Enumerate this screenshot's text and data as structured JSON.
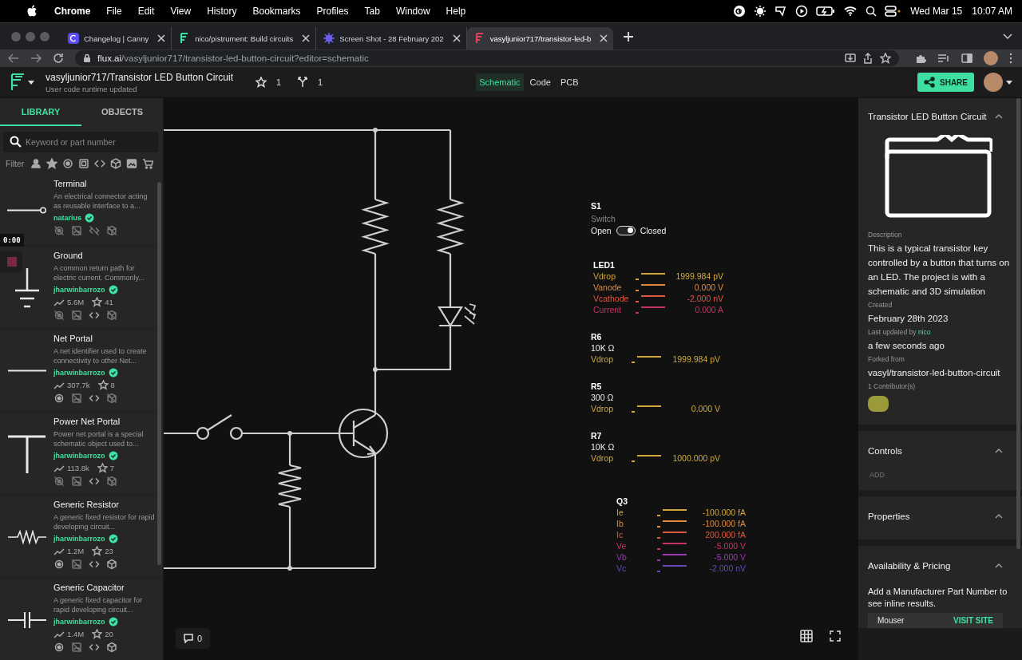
{
  "menu_bar": {
    "app": "Chrome",
    "menus": [
      "File",
      "Edit",
      "View",
      "History",
      "Bookmarks",
      "Profiles",
      "Tab",
      "Window",
      "Help"
    ],
    "date": "Wed Mar 15",
    "time": "10:07 AM"
  },
  "browser": {
    "tabs": [
      {
        "title": "Changelog | Canny",
        "selected": false
      },
      {
        "title": "nico/pistrument: Build circuits",
        "selected": false
      },
      {
        "title": "Screen Shot - 28 February 202",
        "selected": false
      },
      {
        "title": "vasyljunior717/transistor-led-b",
        "selected": true
      }
    ],
    "url_host": "flux.ai",
    "url_path": "/vasyljunior717/transistor-led-button-circuit?editor=schematic"
  },
  "header": {
    "title": "vasyljunior717/Transistor LED Button Circuit",
    "subtitle": "User code runtime updated",
    "stars": "1",
    "forks": "1",
    "editors": [
      {
        "label": "Schematic",
        "selected": true
      },
      {
        "label": "Code",
        "selected": false
      },
      {
        "label": "PCB",
        "selected": false
      }
    ],
    "share": "SHARE"
  },
  "library": {
    "tabs": [
      {
        "label": "LIBRARY",
        "selected": true
      },
      {
        "label": "OBJECTS",
        "selected": false
      }
    ],
    "search": {
      "placeholder": "Keyword or part number"
    },
    "filter_label": "Filter",
    "parts": [
      {
        "kind": "terminal",
        "name": "Terminal",
        "description": "An electrical connector acting as reusable interface to a...",
        "author": "natarius",
        "badges": [
          {
            "kind": "globe",
            "disabled": true
          },
          {
            "kind": "image",
            "disabled": true
          },
          {
            "kind": "code",
            "disabled": true
          },
          {
            "kind": "cube",
            "disabled": true
          }
        ]
      },
      {
        "kind": "ground",
        "name": "Ground",
        "description": "A common return path for electric current. Commonly...",
        "author": "jharwinbarrozo",
        "uses": "5.6M",
        "stars_count": "41",
        "badges": [
          {
            "kind": "globe",
            "disabled": true
          },
          {
            "kind": "image",
            "disabled": true
          },
          {
            "kind": "code",
            "disabled": false
          },
          {
            "kind": "cube",
            "disabled": true
          }
        ]
      },
      {
        "kind": "net",
        "name": "Net Portal",
        "description": "A net identifier used to create connectivity to other Net...",
        "author": "jharwinbarrozo",
        "uses": "307.7k",
        "stars_count": "8",
        "badges": [
          {
            "kind": "globe",
            "disabled": false
          },
          {
            "kind": "image",
            "disabled": true
          },
          {
            "kind": "code",
            "disabled": false
          },
          {
            "kind": "cube",
            "disabled": true
          }
        ]
      },
      {
        "kind": "power",
        "name": "Power Net Portal",
        "description": "Power net portal is a special schematic object used to...",
        "author": "jharwinbarrozo",
        "uses": "113.8k",
        "stars_count": "7",
        "badges": [
          {
            "kind": "globe",
            "disabled": true
          },
          {
            "kind": "image",
            "disabled": true
          },
          {
            "kind": "code",
            "disabled": false
          },
          {
            "kind": "cube",
            "disabled": true
          }
        ]
      },
      {
        "kind": "resistor",
        "name": "Generic Resistor",
        "description": "A generic fixed resistor for rapid developing circuit...",
        "author": "jharwinbarrozo",
        "uses": "1.2M",
        "stars_count": "23",
        "badges": [
          {
            "kind": "globe",
            "disabled": false
          },
          {
            "kind": "image",
            "disabled": true
          },
          {
            "kind": "code",
            "disabled": false
          },
          {
            "kind": "cube",
            "disabled": false
          }
        ]
      },
      {
        "kind": "capacitor",
        "name": "Generic Capacitor",
        "description": "A generic fixed capacitor for rapid developing circuit...",
        "author": "jharwinbarrozo",
        "uses": "1.4M",
        "stars_count": "20",
        "badges": [
          {
            "kind": "globe",
            "disabled": false
          },
          {
            "kind": "image",
            "disabled": true
          },
          {
            "kind": "code",
            "disabled": false
          },
          {
            "kind": "cube",
            "disabled": false
          }
        ]
      }
    ]
  },
  "recording": {
    "time": "0:00"
  },
  "canvas": {
    "switch": {
      "name": "S1",
      "type": "Switch",
      "off_label": "Open",
      "on_label": "Closed",
      "on": true
    },
    "probes": [
      {
        "name": "LED1",
        "rows": [
          {
            "label": "Vdrop",
            "value": "1999.984 pV",
            "color": "#d2a83c"
          },
          {
            "label": "Vanode",
            "value": "0.000 V",
            "color": "#e08a3c"
          },
          {
            "label": "Vcathode",
            "value": "-2.000 nV",
            "color": "#e0573e"
          },
          {
            "label": "Current",
            "value": "0.000 A",
            "color": "#c83262"
          }
        ]
      },
      {
        "name": "R6",
        "rating": "10K Ω",
        "rows": [
          {
            "label": "Vdrop",
            "value": "1999.984 pV",
            "color": "#d2a83c"
          }
        ]
      },
      {
        "name": "R5",
        "rating": "300 Ω",
        "rows": [
          {
            "label": "Vdrop",
            "value": "0.000 V",
            "color": "#d2a83c"
          }
        ]
      },
      {
        "name": "R7",
        "rating": "10K Ω",
        "rows": [
          {
            "label": "Vdrop",
            "value": "1000.000 pV",
            "color": "#d2a83c"
          }
        ]
      },
      {
        "name": "Q3",
        "rows": [
          {
            "label": "Ie",
            "value": "-100.000 fA",
            "color": "#d2a83c"
          },
          {
            "label": "Ib",
            "value": "-100.000 fA",
            "color": "#e08a3c"
          },
          {
            "label": "Ic",
            "value": "200.000 fA",
            "color": "#e0573e"
          },
          {
            "label": "Ve",
            "value": "-5.000 V",
            "color": "#c83262"
          },
          {
            "label": "Vb",
            "value": "-5.000 V",
            "color": "#9a38b0"
          },
          {
            "label": "Vc",
            "value": "-2.000 nV",
            "color": "#6a48b8"
          }
        ]
      }
    ],
    "comments": "0"
  },
  "inspector": {
    "title": "Transistor LED Button Circuit",
    "fields": [
      {
        "label": "Description",
        "value": "This is a typical transistor key controlled by a button that turns on an LED. The project is with a schematic and 3D simulation"
      },
      {
        "label": "Created",
        "value": "February 28th 2023"
      },
      {
        "label": "Last updated by",
        "user": "nico",
        "value": "a few seconds ago"
      },
      {
        "label": "Forked from",
        "value": "vasyl/transistor-led-button-circuit"
      }
    ],
    "contributors": "1 Contributor(s)",
    "controls": {
      "title": "Controls",
      "add": "ADD"
    },
    "properties": {
      "title": "Properties"
    },
    "pricing": {
      "title": "Availability & Pricing",
      "hint": "Add a Manufacturer Part Number to see inline results.",
      "vendor": "Mouser",
      "link": "VISIT SITE"
    }
  }
}
